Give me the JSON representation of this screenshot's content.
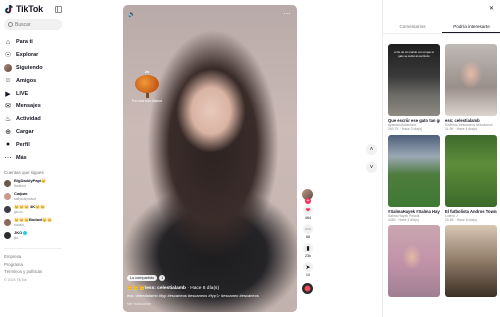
{
  "brand": {
    "name": "TikTok",
    "accent": "#fe2c55",
    "cyan": "#25f4ee"
  },
  "search": {
    "placeholder": "Buscar"
  },
  "nav": [
    {
      "label": "Para ti",
      "icon": "home-icon",
      "active": false
    },
    {
      "label": "Explorar",
      "icon": "compass-icon",
      "active": false
    },
    {
      "label": "Siguiendo",
      "icon": "avatar-icon",
      "active": false
    },
    {
      "label": "Amigos",
      "icon": "friends-icon",
      "active": false
    },
    {
      "label": "LIVE",
      "icon": "live-icon",
      "active": false
    },
    {
      "label": "Mensajes",
      "icon": "message-icon",
      "active": false
    },
    {
      "label": "Actividad",
      "icon": "bell-icon",
      "active": false
    },
    {
      "label": "Cargar",
      "icon": "upload-icon",
      "active": false
    },
    {
      "label": "Perfil",
      "icon": "profile-icon",
      "active": false
    },
    {
      "label": "Más",
      "icon": "more-icon",
      "active": false
    }
  ],
  "following": {
    "title": "Cuentas que sigues",
    "accounts": [
      {
        "name": "BigDaddyPapi👑",
        "handle": "tfoutfoot"
      },
      {
        "name": "Сафия",
        "handle": "safiya.alyousuf"
      },
      {
        "name": "👑👑👑 4K👑👑",
        "handle": "gio.cs"
      },
      {
        "name": "👑👑👑Bodaxi👑👑",
        "handle": "bodaxi_"
      },
      {
        "name": "JKO",
        "handle": "jko"
      }
    ]
  },
  "footer": {
    "links": [
      "Empresa",
      "Programa",
      "Términos y políticas"
    ],
    "copyright": "© 2024 TikTok"
  },
  "video": {
    "overlay_badge": "2x",
    "overlay_caption": "Por una cola blanca",
    "tag": "Lo compartido",
    "tag_count": "1",
    "author": "👑👑👑/ess: celestialamb",
    "time": "· Hace 6 día(s)",
    "hashtags": "ess: celestialamb #fyp #escaneos #escaneos #fypシ #escaneo #escaneos",
    "translation": "Ver traducción"
  },
  "actions": {
    "likes": "464",
    "comments": "68",
    "saves": "23k",
    "shares": "10"
  },
  "right_panel": {
    "tabs": [
      "Comentarios",
      "Podría interesarte"
    ],
    "active_tab": 1,
    "cards": [
      {
        "title": "Que escriir ese gato tan grande 👑 ...",
        "author": "ayamaruitubermoo",
        "stats": "260.7K · Hace 3 día(s)",
        "thumb_label": "el tío de mi marido con el que el gato se subió al escritorio"
      },
      {
        "title": "ess: celestialamb",
        "author": "Бойтесь #escaneos #escaneos",
        "stats": "11.9K · Hace 4 día(s)",
        "thumb_label": ""
      },
      {
        "title": "#SalmaHayek #Salma Hayek Pinault #Hayek...",
        "author": "Salma Hayek Pinault",
        "stats": "4450 · Hace 3 día(s)",
        "thumb_label": ""
      },
      {
        "title": "El futbolista Andros Townsend sufrió un...",
        "author": "Lolexo ✓",
        "stats": "20.5K · Hace 6 día(s)",
        "thumb_label": ""
      },
      {
        "title": "",
        "author": "",
        "stats": "",
        "thumb_label": ""
      },
      {
        "title": "",
        "author": "",
        "stats": "",
        "thumb_label": ""
      }
    ]
  }
}
